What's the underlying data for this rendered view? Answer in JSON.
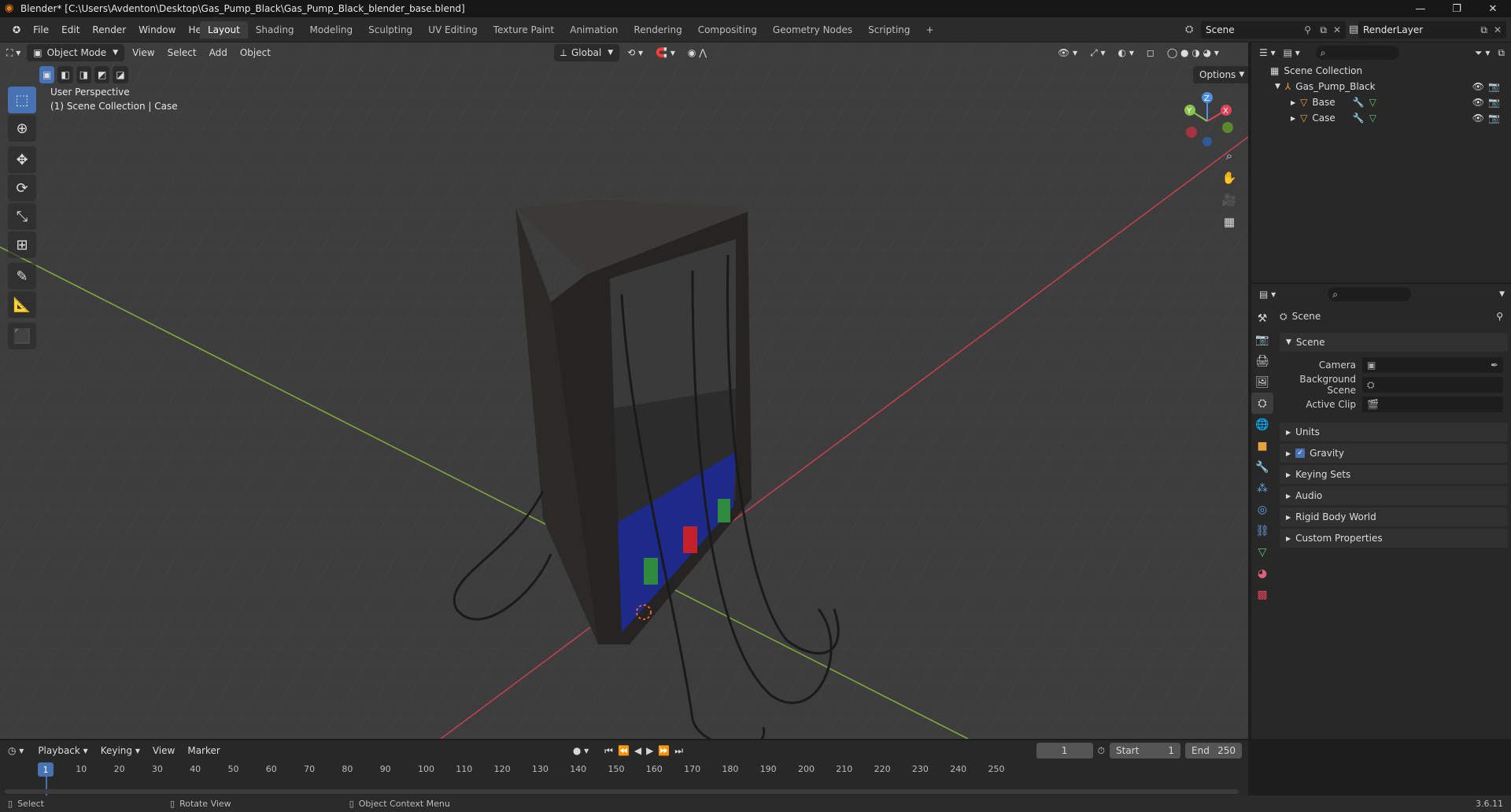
{
  "title": "Blender* [C:\\Users\\Avdenton\\Desktop\\Gas_Pump_Black\\Gas_Pump_Black_blender_base.blend]",
  "menu": [
    "File",
    "Edit",
    "Render",
    "Window",
    "Help"
  ],
  "workspaces": [
    "Layout",
    "Shading",
    "Modeling",
    "Sculpting",
    "UV Editing",
    "Texture Paint",
    "Animation",
    "Rendering",
    "Compositing",
    "Geometry Nodes",
    "Scripting"
  ],
  "scene": "Scene",
  "render_layer": "RenderLayer",
  "viewport": {
    "mode": "Object Mode",
    "menu": [
      "View",
      "Select",
      "Add",
      "Object"
    ],
    "transform": "Global",
    "options": "Options",
    "perspective": "User Perspective",
    "collection": "(1) Scene Collection | Case",
    "axis_colors": {
      "x": "#e0445a",
      "y": "#8bc34a",
      "z": "#4f8fe0"
    }
  },
  "outliner": {
    "root": "Scene Collection",
    "items": [
      {
        "label": "Gas_Pump_Black"
      },
      {
        "label": "Base"
      },
      {
        "label": "Case"
      }
    ]
  },
  "properties": {
    "header": "Scene",
    "section": "Scene",
    "rows": [
      {
        "label": "Camera"
      },
      {
        "label": "Background Scene"
      },
      {
        "label": "Active Clip"
      }
    ],
    "panels": [
      "Units",
      "Gravity",
      "Keying Sets",
      "Audio",
      "Rigid Body World",
      "Custom Properties"
    ],
    "gravity_enabled": true
  },
  "timeline": {
    "menu": [
      "Playback",
      "Keying",
      "View",
      "Marker"
    ],
    "current_frame": "1",
    "start_label": "Start",
    "start": "1",
    "end_label": "End",
    "end": "250",
    "ruler": [
      "10",
      "20",
      "30",
      "40",
      "50",
      "60",
      "70",
      "80",
      "90",
      "100",
      "110",
      "120",
      "130",
      "140",
      "150",
      "160",
      "170",
      "180",
      "190",
      "200",
      "210",
      "220",
      "230",
      "240",
      "250"
    ]
  },
  "status": {
    "select": "Select",
    "rotate": "Rotate View",
    "context": "Object Context Menu",
    "version": "3.6.11"
  }
}
